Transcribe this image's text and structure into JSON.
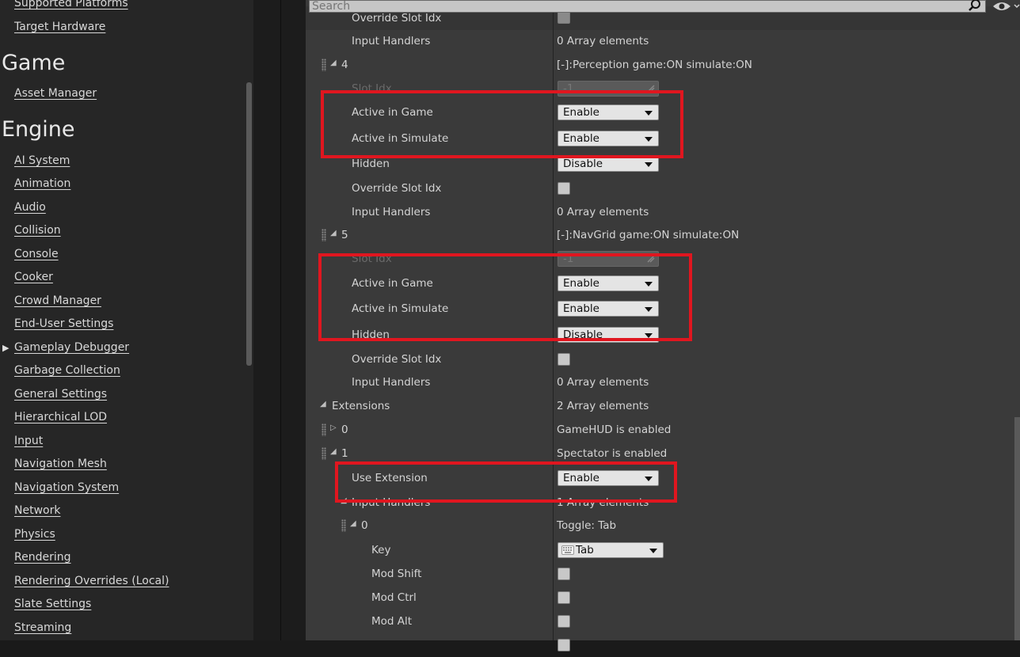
{
  "sidebar": {
    "top_items": [
      "Supported Platforms",
      "Target Hardware"
    ],
    "game_heading": "Game",
    "game_items": [
      "Asset Manager"
    ],
    "engine_heading": "Engine",
    "engine_items": [
      "AI System",
      "Animation",
      "Audio",
      "Collision",
      "Console",
      "Cooker",
      "Crowd Manager",
      "End-User Settings",
      "Gameplay Debugger",
      "Garbage Collection",
      "General Settings",
      "Hierarchical LOD",
      "Input",
      "Navigation Mesh",
      "Navigation System",
      "Network",
      "Physics",
      "Rendering",
      "Rendering Overrides (Local)",
      "Slate Settings",
      "Streaming"
    ]
  },
  "search": {
    "placeholder": "Search"
  },
  "rows": [
    {
      "label": "Override Slot Idx",
      "value": null
    },
    {
      "label": "Input Handlers",
      "value": "0 Array elements"
    },
    {
      "label": "4",
      "value": "[-]:Perception game:ON simulate:ON"
    },
    {
      "label": "Slot Idx",
      "value": "-1"
    },
    {
      "label": "Active in Game",
      "value": "Enable"
    },
    {
      "label": "Active in Simulate",
      "value": "Enable"
    },
    {
      "label": "Hidden",
      "value": "Disable"
    },
    {
      "label": "Override Slot Idx",
      "value": null
    },
    {
      "label": "Input Handlers",
      "value": "0 Array elements"
    },
    {
      "label": "5",
      "value": "[-]:NavGrid game:ON simulate:ON"
    },
    {
      "label": "Slot Idx",
      "value": "-1"
    },
    {
      "label": "Active in Game",
      "value": "Enable"
    },
    {
      "label": "Active in Simulate",
      "value": "Enable"
    },
    {
      "label": "Hidden",
      "value": "Disable"
    },
    {
      "label": "Override Slot Idx",
      "value": null
    },
    {
      "label": "Input Handlers",
      "value": "0 Array elements"
    },
    {
      "label": "Extensions",
      "value": "2 Array elements"
    },
    {
      "label": "0",
      "value": "GameHUD is enabled"
    },
    {
      "label": "1",
      "value": "Spectator is enabled"
    },
    {
      "label": "Use Extension",
      "value": "Enable"
    },
    {
      "label": "Input Handlers",
      "value": "1 Array elements"
    },
    {
      "label": "0",
      "value": "Toggle: Tab"
    },
    {
      "label": "Key",
      "value": "Tab"
    },
    {
      "label": "Mod Shift",
      "value": null
    },
    {
      "label": "Mod Ctrl",
      "value": null
    },
    {
      "label": "Mod Alt",
      "value": null
    }
  ],
  "colors": {
    "highlight": "#e0161f",
    "panel_bg": "#3a3a3a",
    "sidebar_bg": "#262626"
  },
  "icons": {
    "search": "search-icon",
    "visibility": "eye-icon",
    "keyboard": "keyboard-icon"
  }
}
